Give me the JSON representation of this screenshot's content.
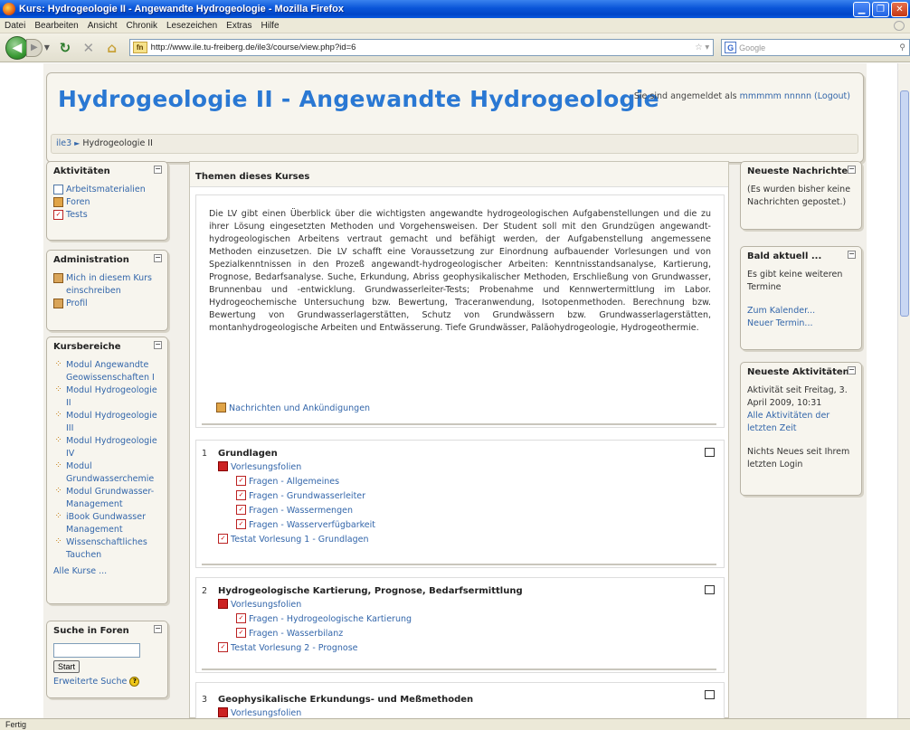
{
  "browser": {
    "window_title": "Kurs: Hydrogeologie II - Angewandte Hydrogeologie - Mozilla Firefox",
    "menu": [
      "Datei",
      "Bearbeiten",
      "Ansicht",
      "Chronik",
      "Lesezeichen",
      "Extras",
      "Hilfe"
    ],
    "url": "http://www.ile.tu-freiberg.de/ile3/course/view.php?id=6",
    "search_placeholder": "Google",
    "status": "Fertig"
  },
  "header": {
    "title": "Hydrogeologie II - Angewandte Hydrogeologie",
    "login_prefix": "Sie sind angemeldet als",
    "login_user": "mmmmm nnnnn",
    "logout": "(Logout)"
  },
  "breadcrumb": {
    "root": "ile3",
    "current": "Hydrogeologie II"
  },
  "blocks": {
    "aktivitaeten": {
      "title": "Aktivitäten",
      "items": [
        "Arbeitsmaterialien",
        "Foren",
        "Tests"
      ]
    },
    "administration": {
      "title": "Administration",
      "items": [
        "Mich in diesem Kurs einschreiben",
        "Profil"
      ]
    },
    "kursbereiche": {
      "title": "Kursbereiche",
      "items": [
        "Modul Angewandte Geowissenschaften I",
        "Modul Hydrogeologie II",
        "Modul Hydrogeologie III",
        "Modul Hydrogeologie IV",
        "Modul Grundwasserchemie",
        "Modul Grundwasser-Management",
        "iBook Gundwasser Management",
        "Wissenschaftliches Tauchen"
      ],
      "all": "Alle Kurse ..."
    },
    "suche": {
      "title": "Suche in Foren",
      "button": "Start",
      "advanced": "Erweiterte Suche"
    },
    "nachrichten": {
      "title": "Neueste Nachrichten",
      "text": "(Es wurden bisher keine Nachrichten gepostet.)"
    },
    "bald": {
      "title": "Bald aktuell ...",
      "text": "Es gibt keine weiteren Termine",
      "calendar": "Zum Kalender...",
      "new": "Neuer Termin..."
    },
    "aktivitaeten_neu": {
      "title": "Neueste Aktivitäten",
      "since": "Aktivität seit Freitag, 3. April 2009, 10:31",
      "all": "Alle Aktivitäten der letzten Zeit",
      "none": "Nichts Neues seit Ihrem letzten Login"
    }
  },
  "main": {
    "title": "Themen dieses Kurses",
    "summary": "Die LV gibt einen Überblick über die wichtigsten angewandte hydrogeologischen Aufgabenstellungen und die zu ihrer Lösung eingesetzten Methoden und Vorgehensweisen. Der Student soll mit den Grundzügen angewandt-hydrogeologischen Arbeitens vertraut gemacht und befähigt werden, der Aufgabenstellung angemessene Methoden einzusetzen. Die LV schafft eine Voraussetzung zur Einordnung aufbauender Vorlesungen und von Spezialkenntnissen in den Prozeß angewandt-hydrogeologischer Arbeiten: Kenntnisstandsanalyse, Kartierung, Prognose, Bedarfsanalyse. Suche, Erkundung, Abriss geophysikalischer Methoden, Erschließung von Grundwasser, Brunnenbau und -entwicklung. Grundwasserleiter-Tests; Probenahme und Kennwertermittlung im Labor. Hydrogeochemische Untersuchung bzw. Bewertung, Traceranwendung, Isotopenmethoden. Berechnung bzw. Bewertung von Grundwasserlagerstätten, Schutz von Grundwässern bzw. Grundwasserlagerstätten, montanhydrogeologische Arbeiten und Entwässerung. Tiefe Grundwässer, Paläohydrogeologie, Hydrogeothermie.",
    "news_forum": "Nachrichten und Ankündigungen",
    "sections": [
      {
        "num": "1",
        "title": "Grundlagen",
        "slides": "Vorlesungsfolien",
        "questions": [
          "Fragen - Allgemeines",
          "Fragen - Grundwasserleiter",
          "Fragen - Wassermengen",
          "Fragen - Wasserverfügbarkeit"
        ],
        "test": "Testat Vorlesung 1 - Grundlagen"
      },
      {
        "num": "2",
        "title": "Hydrogeologische Kartierung, Prognose, Bedarfsermittlung",
        "slides": "Vorlesungsfolien",
        "questions": [
          "Fragen - Hydrogeologische Kartierung",
          "Fragen - Wasserbilanz"
        ],
        "test": "Testat Vorlesung 2 - Prognose"
      },
      {
        "num": "3",
        "title": "Geophysikalische Erkundungs- und Meßmethoden",
        "slides": "Vorlesungsfolien"
      }
    ]
  }
}
